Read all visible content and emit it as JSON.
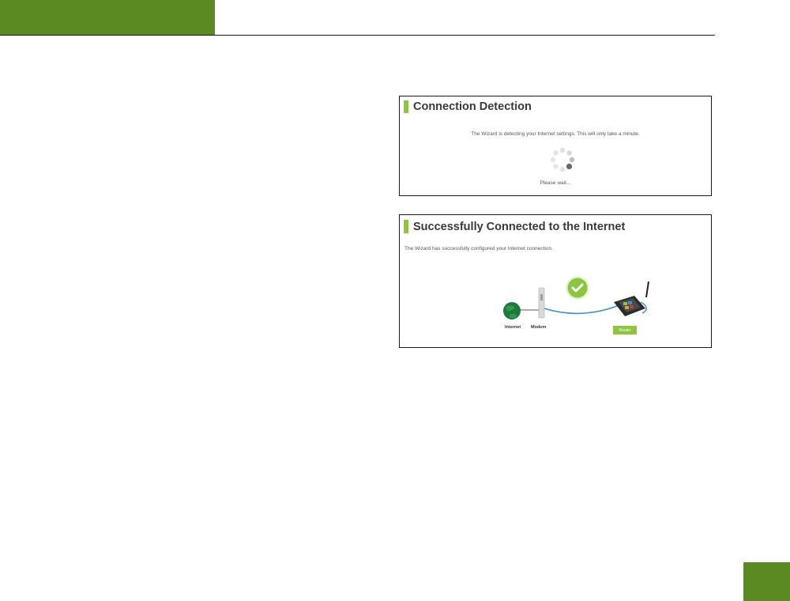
{
  "detection": {
    "title": "Connection Detection",
    "message": "The Wizard is detecting your Internet settings. This will only take a minute.",
    "wait": "Please wait..."
  },
  "success": {
    "title": "Successfully Connected to the Internet",
    "message": "The Wizard has successfully configured your Internet connection.",
    "labels": {
      "internet": "Internet",
      "modem": "Modem",
      "router": "Router"
    }
  },
  "colors": {
    "brand_green": "#5b8a23",
    "accent_green": "#8cc63f",
    "cable_blue": "#3a8fd0"
  }
}
